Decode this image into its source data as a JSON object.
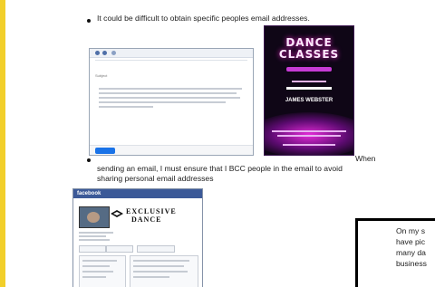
{
  "bullets": {
    "point1": "It could be difficult to obtain specific peoples email addresses.",
    "point2_line1": "When",
    "point2_line2": "sending an email, I must ensure that I BCC people in the email to avoid",
    "point2_line3": "sharing personal email addresses"
  },
  "email_screenshot": {
    "subject_label": "Subject"
  },
  "poster": {
    "title_line1": "DANCE",
    "title_line2": "CLASSES",
    "teacher": "JAMES WEBSTER"
  },
  "facebook_screenshot": {
    "header": "facebook",
    "cover_text_line1": "EXCLUSIVE",
    "cover_text_line2": "DANCE"
  },
  "sidebox": {
    "line1": "On my s",
    "line2": "have pic",
    "line3": "many da",
    "line4": "business"
  }
}
